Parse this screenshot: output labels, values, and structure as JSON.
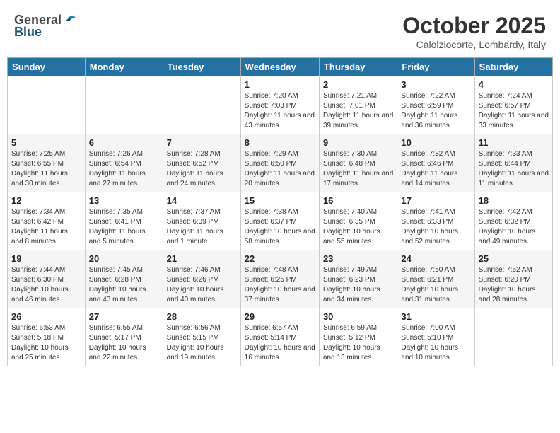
{
  "header": {
    "logo_general": "General",
    "logo_blue": "Blue",
    "month": "October 2025",
    "location": "Calolziocorte, Lombardy, Italy"
  },
  "weekdays": [
    "Sunday",
    "Monday",
    "Tuesday",
    "Wednesday",
    "Thursday",
    "Friday",
    "Saturday"
  ],
  "weeks": [
    [
      {
        "day": "",
        "info": ""
      },
      {
        "day": "",
        "info": ""
      },
      {
        "day": "",
        "info": ""
      },
      {
        "day": "1",
        "info": "Sunrise: 7:20 AM\nSunset: 7:03 PM\nDaylight: 11 hours and 43 minutes."
      },
      {
        "day": "2",
        "info": "Sunrise: 7:21 AM\nSunset: 7:01 PM\nDaylight: 11 hours and 39 minutes."
      },
      {
        "day": "3",
        "info": "Sunrise: 7:22 AM\nSunset: 6:59 PM\nDaylight: 11 hours and 36 minutes."
      },
      {
        "day": "4",
        "info": "Sunrise: 7:24 AM\nSunset: 6:57 PM\nDaylight: 11 hours and 33 minutes."
      }
    ],
    [
      {
        "day": "5",
        "info": "Sunrise: 7:25 AM\nSunset: 6:55 PM\nDaylight: 11 hours and 30 minutes."
      },
      {
        "day": "6",
        "info": "Sunrise: 7:26 AM\nSunset: 6:54 PM\nDaylight: 11 hours and 27 minutes."
      },
      {
        "day": "7",
        "info": "Sunrise: 7:28 AM\nSunset: 6:52 PM\nDaylight: 11 hours and 24 minutes."
      },
      {
        "day": "8",
        "info": "Sunrise: 7:29 AM\nSunset: 6:50 PM\nDaylight: 11 hours and 20 minutes."
      },
      {
        "day": "9",
        "info": "Sunrise: 7:30 AM\nSunset: 6:48 PM\nDaylight: 11 hours and 17 minutes."
      },
      {
        "day": "10",
        "info": "Sunrise: 7:32 AM\nSunset: 6:46 PM\nDaylight: 11 hours and 14 minutes."
      },
      {
        "day": "11",
        "info": "Sunrise: 7:33 AM\nSunset: 6:44 PM\nDaylight: 11 hours and 11 minutes."
      }
    ],
    [
      {
        "day": "12",
        "info": "Sunrise: 7:34 AM\nSunset: 6:42 PM\nDaylight: 11 hours and 8 minutes."
      },
      {
        "day": "13",
        "info": "Sunrise: 7:35 AM\nSunset: 6:41 PM\nDaylight: 11 hours and 5 minutes."
      },
      {
        "day": "14",
        "info": "Sunrise: 7:37 AM\nSunset: 6:39 PM\nDaylight: 11 hours and 1 minute."
      },
      {
        "day": "15",
        "info": "Sunrise: 7:38 AM\nSunset: 6:37 PM\nDaylight: 10 hours and 58 minutes."
      },
      {
        "day": "16",
        "info": "Sunrise: 7:40 AM\nSunset: 6:35 PM\nDaylight: 10 hours and 55 minutes."
      },
      {
        "day": "17",
        "info": "Sunrise: 7:41 AM\nSunset: 6:33 PM\nDaylight: 10 hours and 52 minutes."
      },
      {
        "day": "18",
        "info": "Sunrise: 7:42 AM\nSunset: 6:32 PM\nDaylight: 10 hours and 49 minutes."
      }
    ],
    [
      {
        "day": "19",
        "info": "Sunrise: 7:44 AM\nSunset: 6:30 PM\nDaylight: 10 hours and 46 minutes."
      },
      {
        "day": "20",
        "info": "Sunrise: 7:45 AM\nSunset: 6:28 PM\nDaylight: 10 hours and 43 minutes."
      },
      {
        "day": "21",
        "info": "Sunrise: 7:46 AM\nSunset: 6:26 PM\nDaylight: 10 hours and 40 minutes."
      },
      {
        "day": "22",
        "info": "Sunrise: 7:48 AM\nSunset: 6:25 PM\nDaylight: 10 hours and 37 minutes."
      },
      {
        "day": "23",
        "info": "Sunrise: 7:49 AM\nSunset: 6:23 PM\nDaylight: 10 hours and 34 minutes."
      },
      {
        "day": "24",
        "info": "Sunrise: 7:50 AM\nSunset: 6:21 PM\nDaylight: 10 hours and 31 minutes."
      },
      {
        "day": "25",
        "info": "Sunrise: 7:52 AM\nSunset: 6:20 PM\nDaylight: 10 hours and 28 minutes."
      }
    ],
    [
      {
        "day": "26",
        "info": "Sunrise: 6:53 AM\nSunset: 5:18 PM\nDaylight: 10 hours and 25 minutes."
      },
      {
        "day": "27",
        "info": "Sunrise: 6:55 AM\nSunset: 5:17 PM\nDaylight: 10 hours and 22 minutes."
      },
      {
        "day": "28",
        "info": "Sunrise: 6:56 AM\nSunset: 5:15 PM\nDaylight: 10 hours and 19 minutes."
      },
      {
        "day": "29",
        "info": "Sunrise: 6:57 AM\nSunset: 5:14 PM\nDaylight: 10 hours and 16 minutes."
      },
      {
        "day": "30",
        "info": "Sunrise: 6:59 AM\nSunset: 5:12 PM\nDaylight: 10 hours and 13 minutes."
      },
      {
        "day": "31",
        "info": "Sunrise: 7:00 AM\nSunset: 5:10 PM\nDaylight: 10 hours and 10 minutes."
      },
      {
        "day": "",
        "info": ""
      }
    ]
  ]
}
